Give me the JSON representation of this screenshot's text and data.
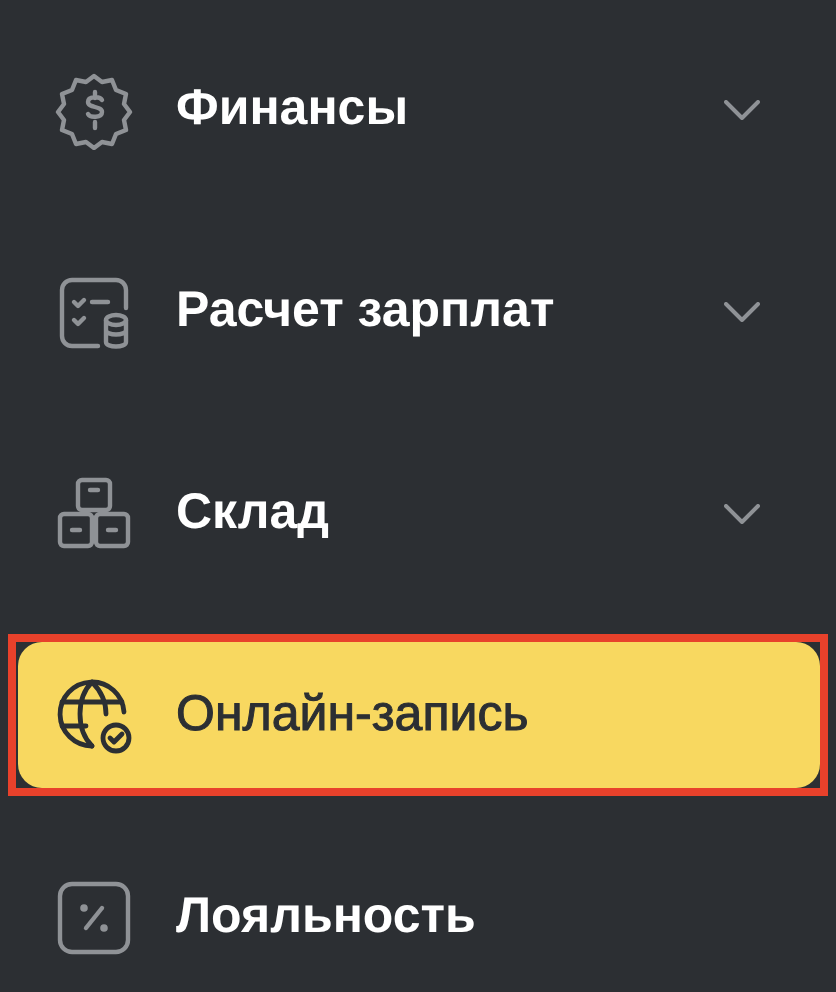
{
  "sidebar": {
    "items": [
      {
        "label": "Финансы",
        "kind": "group",
        "expanded": false,
        "selected": false,
        "highlighted": false
      },
      {
        "label": "Расчет зарплат",
        "kind": "group",
        "expanded": false,
        "selected": false,
        "highlighted": false
      },
      {
        "label": "Склад",
        "kind": "group",
        "expanded": false,
        "selected": false,
        "highlighted": false
      },
      {
        "label": "Онлайн-запись",
        "kind": "link",
        "selected": true,
        "highlighted": true
      },
      {
        "label": "Лояльность",
        "kind": "link",
        "selected": false,
        "highlighted": false
      }
    ]
  }
}
